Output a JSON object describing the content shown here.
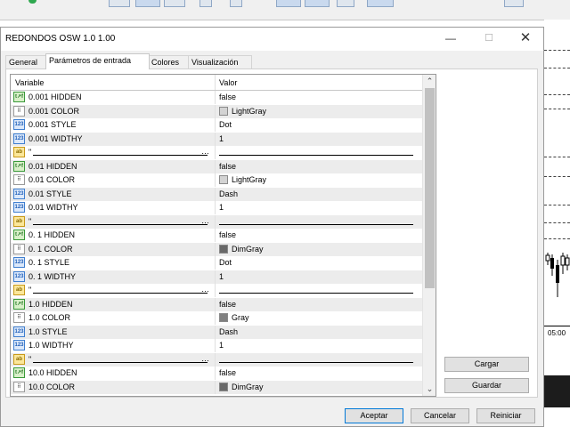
{
  "dialog": {
    "title": "REDONDOS OSW 1.0 1.00",
    "min_glyph": "—",
    "max_glyph": "☐",
    "close_glyph": "✕"
  },
  "tabs": [
    {
      "label": "General"
    },
    {
      "label": "Parámetros de entrada"
    },
    {
      "label": "Colores"
    },
    {
      "label": "Visualización"
    }
  ],
  "grid": {
    "columns": [
      "Variable",
      "Valor"
    ],
    "rows": [
      {
        "type": "bool",
        "icon": "bool-icon",
        "name": "0.001 HIDDEN",
        "value": "false"
      },
      {
        "type": "color",
        "icon": "color-icon",
        "name": "0.001 COLOR",
        "value": "LightGray",
        "swatch": "#d3d3d3"
      },
      {
        "type": "int",
        "icon": "int-icon",
        "name": "0.001 STYLE",
        "value": "Dot"
      },
      {
        "type": "int",
        "icon": "int-icon",
        "name": "0.001 WIDTHY",
        "value": "1"
      },
      {
        "type": "str",
        "icon": "string-icon",
        "name": "\"",
        "value": ""
      },
      {
        "type": "bool",
        "icon": "bool-icon",
        "name": "0.01 HIDDEN",
        "value": "false"
      },
      {
        "type": "color",
        "icon": "color-icon",
        "name": "0.01 COLOR",
        "value": "LightGray",
        "swatch": "#d3d3d3"
      },
      {
        "type": "int",
        "icon": "int-icon",
        "name": "0.01 STYLE",
        "value": "Dash"
      },
      {
        "type": "int",
        "icon": "int-icon",
        "name": "0.01 WIDTHY",
        "value": "1"
      },
      {
        "type": "str",
        "icon": "string-icon",
        "name": "\"",
        "value": ""
      },
      {
        "type": "bool",
        "icon": "bool-icon",
        "name": "0. 1 HIDDEN",
        "value": "false"
      },
      {
        "type": "color",
        "icon": "color-icon",
        "name": "0. 1 COLOR",
        "value": "DimGray",
        "swatch": "#696969"
      },
      {
        "type": "int",
        "icon": "int-icon",
        "name": "0. 1 STYLE",
        "value": "Dot"
      },
      {
        "type": "int",
        "icon": "int-icon",
        "name": "0. 1 WIDTHY",
        "value": "1"
      },
      {
        "type": "str",
        "icon": "string-icon",
        "name": "\"",
        "value": ""
      },
      {
        "type": "bool",
        "icon": "bool-icon",
        "name": "1.0 HIDDEN",
        "value": "false"
      },
      {
        "type": "color",
        "icon": "color-icon",
        "name": "1.0 COLOR",
        "value": "Gray",
        "swatch": "#808080"
      },
      {
        "type": "int",
        "icon": "int-icon",
        "name": "1.0 STYLE",
        "value": "Dash"
      },
      {
        "type": "int",
        "icon": "int-icon",
        "name": "1.0 WIDTHY",
        "value": "1"
      },
      {
        "type": "str",
        "icon": "string-icon",
        "name": "\"",
        "value": ""
      },
      {
        "type": "bool",
        "icon": "bool-icon",
        "name": "10.0 HIDDEN",
        "value": "false"
      },
      {
        "type": "color",
        "icon": "color-icon",
        "name": "10.0 COLOR",
        "value": "DimGray",
        "swatch": "#696969"
      }
    ],
    "dots": "…"
  },
  "icon_glyphs": {
    "bool": "t↗f",
    "color": "⠿",
    "int": "123",
    "str": "ab"
  },
  "scroll": {
    "up": "⌃",
    "down": "⌄",
    "thumb_fraction": 0.68
  },
  "buttons": {
    "load": "Cargar",
    "save": "Guardar",
    "ok": "Aceptar",
    "cancel": "Cancelar",
    "reset": "Reiniciar"
  },
  "background": {
    "time_label": "05:00",
    "accent": "#0078d7"
  }
}
